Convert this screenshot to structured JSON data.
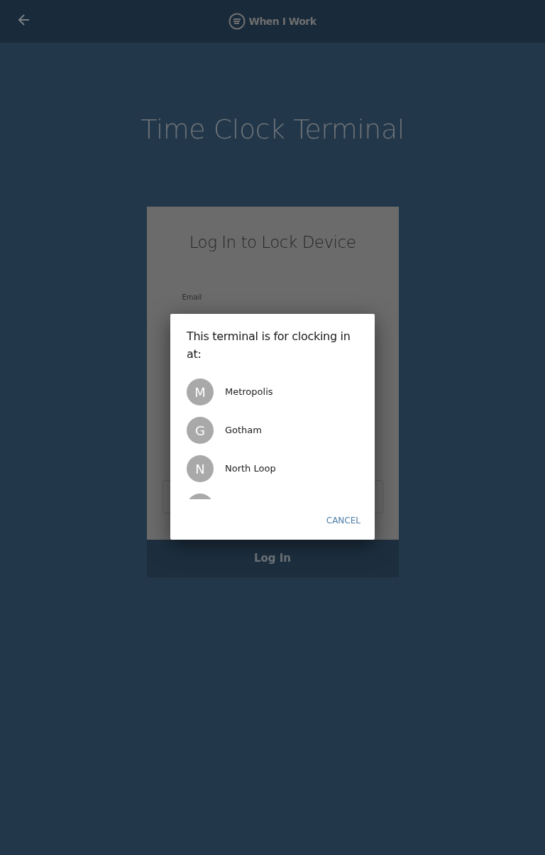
{
  "header": {
    "brand": "When I Work"
  },
  "page_title": "Time Clock Terminal",
  "login_card": {
    "title": "Log In to Lock Device",
    "email_label": "Email",
    "submit": "Log In"
  },
  "dialog": {
    "title": "This terminal is for clocking in at:",
    "locations": [
      {
        "kind": "full",
        "initial": "M",
        "name": "Metropolis"
      },
      {
        "kind": "full",
        "initial": "G",
        "name": "Gotham"
      },
      {
        "kind": "full",
        "initial": "N",
        "name": "North Loop"
      },
      {
        "kind": "partial"
      }
    ],
    "cancel": "CANCEL"
  }
}
